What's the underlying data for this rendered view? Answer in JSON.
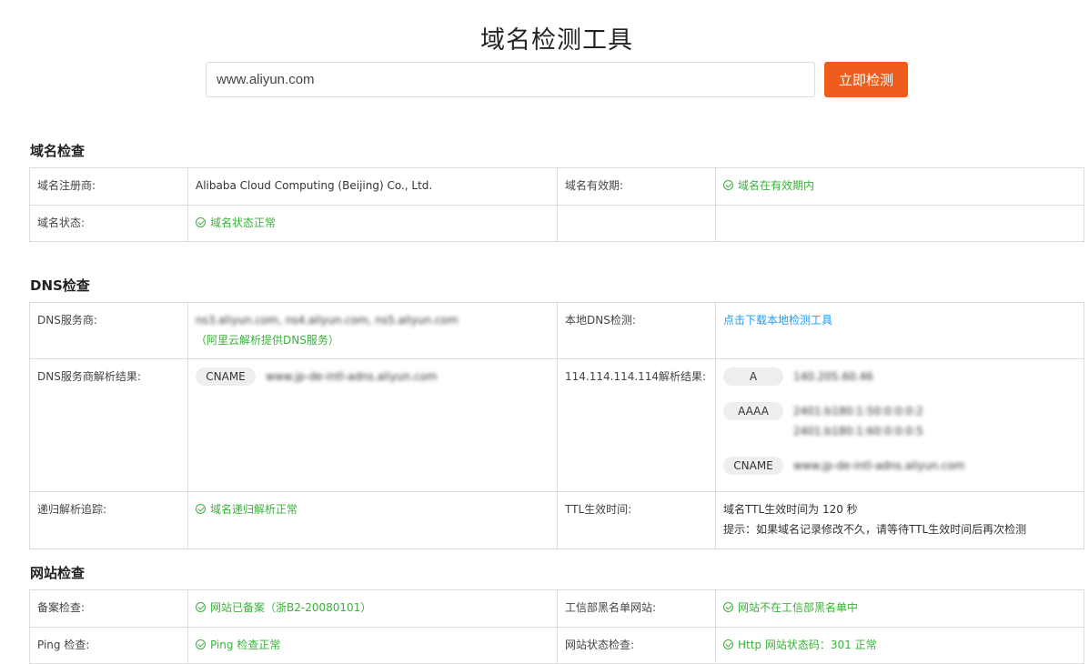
{
  "page": {
    "title": "域名检测工具",
    "search_value": "www.aliyun.com",
    "button_label": "立即检测"
  },
  "domain_check": {
    "title": "域名检查",
    "registrar_label": "域名注册商:",
    "registrar_value": "Alibaba Cloud Computing (Beijing) Co., Ltd.",
    "validity_label": "域名有效期:",
    "validity_value": "域名在有效期内",
    "status_label": "域名状态:",
    "status_value": "域名状态正常"
  },
  "dns_check": {
    "title": "DNS检查",
    "provider_label": "DNS服务商:",
    "provider_value": "ns3.aliyun.com, ns4.aliyun.com, ns5.aliyun.com",
    "provider_note": "（阿里云解析提供DNS服务）",
    "local_label": "本地DNS检测:",
    "local_link": "点击下载本地检测工具",
    "result_label": "DNS服务商解析结果:",
    "result_type": "CNAME",
    "result_value": "www.jp-de-intl-adns.aliyun.com",
    "public_label": "114.114.114.114解析结果:",
    "public_records": [
      {
        "type": "A",
        "values": [
          "140.205.60.46"
        ]
      },
      {
        "type": "AAAA",
        "values": [
          "2401:b180:1:50:0:0:0:2",
          "2401:b180:1:60:0:0:0:5"
        ]
      },
      {
        "type": "CNAME",
        "values": [
          "www.jp-de-intl-adns.aliyun.com"
        ]
      }
    ],
    "recursive_label": "递归解析追踪:",
    "recursive_value": "域名递归解析正常",
    "ttl_label": "TTL生效时间:",
    "ttl_value": "域名TTL生效时间为 120 秒",
    "ttl_hint": "提示：如果域名记录修改不久，请等待TTL生效时间后再次检测"
  },
  "site_check": {
    "title": "网站检查",
    "icp_label": "备案检查:",
    "icp_value": "网站已备案（浙B2-20080101）",
    "blacklist_label": "工信部黑名单网站:",
    "blacklist_value": "网站不在工信部黑名单中",
    "ping_label": "Ping 检查:",
    "ping_value": "Ping 检查正常",
    "status_label": "网站状态检查:",
    "status_value": "Http 网站状态码：301 正常"
  },
  "colors": {
    "accent": "#f05c1b",
    "ok": "#3bb13b",
    "link": "#1e9bf0"
  }
}
